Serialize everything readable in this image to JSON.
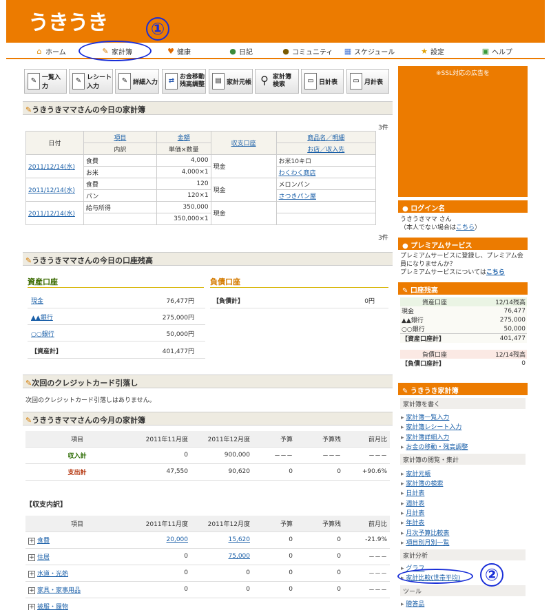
{
  "logo": "うきうき",
  "nav": [
    "ホーム",
    "家計簿",
    "健康",
    "日記",
    "コミュニティ",
    "スケジュール",
    "設定",
    "ヘルプ"
  ],
  "annotations": [
    "①",
    "②"
  ],
  "toolbar": [
    "一覧入力",
    "レシート入力",
    "詳細入力",
    "お金移動 残高調整",
    "家計元帳",
    "家計簿 検索",
    "日計表",
    "月計表"
  ],
  "today": {
    "title": "うきうきママさんの今日の家計簿",
    "count": "3件",
    "headers": {
      "date": "日付",
      "item": "項目",
      "sub": "内訳",
      "amount": "金額",
      "unit": "単価×数量",
      "account": "収支口座",
      "product": "商品名／明細",
      "shop": "お店／収入先"
    },
    "rows": [
      {
        "date": "2011/12/14(水)",
        "item": "食費",
        "amount": "4,000",
        "sub": "お米",
        "unit": "4,000×1",
        "account": "現金",
        "product": "お米10キロ",
        "shop": "わくわく商店"
      },
      {
        "date": "2011/12/14(水)",
        "item": "食費",
        "amount": "120",
        "sub": "パン",
        "unit": "120×1",
        "account": "現金",
        "product": "メロンパン",
        "shop": "さつきパン屋"
      },
      {
        "date": "2011/12/14(水)",
        "item": "給与所得",
        "amount": "350,000",
        "sub": "",
        "unit": "350,000×1",
        "account": "現金",
        "product": "",
        "shop": ""
      }
    ]
  },
  "balance": {
    "title": "うきうきママさんの今日の口座残高",
    "assets_head": "資産口座",
    "debt_head": "負債口座",
    "assets": [
      {
        "name": "現金",
        "value": "76,477円"
      },
      {
        "name": "▲▲銀行",
        "value": "275,000円"
      },
      {
        "name": "○○銀行",
        "value": "50,000円"
      }
    ],
    "asset_total_label": "【資産計】",
    "asset_total": "401,477円",
    "debt_total_label": "【負債計】",
    "debt_total": "0円"
  },
  "credit": {
    "title": "次回のクレジットカード引落し",
    "text": "次回のクレジットカード引落しはありません。"
  },
  "month": {
    "title": "うきうきママさんの今月の家計簿",
    "headers": [
      "項目",
      "2011年11月度",
      "2011年12月度",
      "予算",
      "予算残",
      "前月比"
    ],
    "rows": [
      {
        "label": "収入計",
        "c1": "0",
        "c2": "900,000",
        "c3": "－－－",
        "c4": "－－－",
        "c5": "－－－"
      },
      {
        "label": "支出計",
        "c1": "47,550",
        "c2": "90,620",
        "c3": "0",
        "c4": "0",
        "c5": "+90.6%"
      }
    ]
  },
  "breakdown": {
    "title": "【収支内訳】",
    "headers": [
      "項目",
      "2011年11月度",
      "2011年12月度",
      "予算",
      "予算残",
      "前月比"
    ],
    "rows": [
      {
        "label": "食費",
        "c1": "20,000",
        "c2": "15,620",
        "c3": "0",
        "c4": "0",
        "c5": "-21.9%"
      },
      {
        "label": "住居",
        "c1": "0",
        "c2": "75,000",
        "c3": "0",
        "c4": "0",
        "c5": "－－－"
      },
      {
        "label": "水道・光熱",
        "c1": "0",
        "c2": "0",
        "c3": "0",
        "c4": "0",
        "c5": "－－－"
      },
      {
        "label": "家具・家事用品",
        "c1": "0",
        "c2": "0",
        "c3": "0",
        "c4": "0",
        "c5": "－－－"
      },
      {
        "label": "被服・履物",
        "c1": "",
        "c2": "",
        "c3": "",
        "c4": "",
        "c5": ""
      }
    ]
  },
  "sidebar": {
    "ad": "※SSL対応の広告を",
    "login_head": "ログイン名",
    "login_text": "うきうきママ さん",
    "login_note": "（本人でない場合は",
    "login_link": "こちら",
    "login_close": "）",
    "premium_head": "プレミアムサービス",
    "premium_text": "プレミアムサービスに登録し、プレミアム会員になりませんか？",
    "premium_text2": "プレミアムサービスについては",
    "premium_link": "こちら",
    "balance_head": "口座残高",
    "asset_col": "資産口座",
    "date_col": "12/14残高",
    "bal_rows": [
      {
        "name": "現金",
        "value": "76,477"
      },
      {
        "name": "▲▲銀行",
        "value": "275,000"
      },
      {
        "name": "○○銀行",
        "value": "50,000"
      }
    ],
    "bal_total_label": "【資産口座計】",
    "bal_total": "401,477",
    "debt_col": "負債口座",
    "debt_total_label": "【負債口座計】",
    "debt_total": "0",
    "kakeibo_head": "うきうき家計簿",
    "write_sub": "家計簿を書く",
    "write_links": [
      "家計簿一覧入力",
      "家計簿レシート入力",
      "家計簿詳細入力",
      "お金の移動・残高調整"
    ],
    "view_sub": "家計簿の閲覧・集計",
    "view_links": [
      "家計元帳",
      "家計簿の検索",
      "日計表",
      "週計表",
      "月計表",
      "年計表",
      "月次予算比較表",
      "項目別月別一覧"
    ],
    "analysis_sub": "家計分析",
    "analysis_links": [
      "グラフ",
      "家計比較(世帯平均)"
    ],
    "tool_sub": "ツール",
    "tool_links": [
      "贈答品"
    ]
  }
}
